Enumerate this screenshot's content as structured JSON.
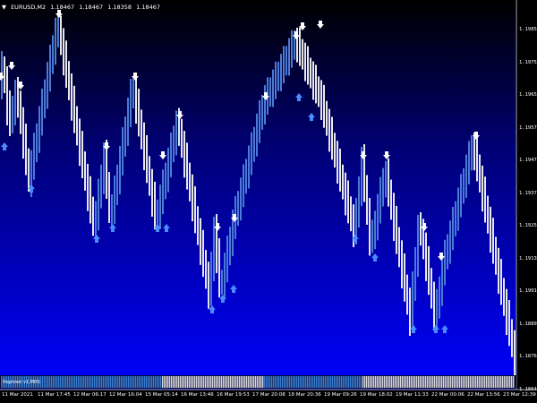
{
  "window": {
    "symbol": "EURUSD,M2",
    "bid": "1.18467",
    "high": "1.18467",
    "low": "1.18358",
    "close": "1.18467"
  },
  "indicator": {
    "label": "Nephred v1.MHS"
  },
  "price_axis": [
    "1.19855",
    "1.19755",
    "1.19655",
    "1.19570",
    "1.19475",
    "1.19375",
    "1.19255",
    "1.19130",
    "1.19010",
    "1.18890",
    "1.18765",
    "1.18645"
  ],
  "time_axis": [
    "11 Mar 2021",
    "11 Mar 17:45",
    "12 Mar 06:17",
    "12 Mar 16:04",
    "15 Mar 05:14",
    "16 Mar 13:46",
    "16 Mar 19:53",
    "17 Mar 20:08",
    "18 Mar 20:36",
    "19 Mar 09:26",
    "19 Mar 18:02",
    "19 Mar 11:33",
    "22 Mar 00:06",
    "22 Mar 13:56",
    "23 Mar 12:39"
  ],
  "colors": {
    "bull_bar": "#4a7bd6",
    "bear_bar": "#e8e8ea",
    "down_arrow": "#ffffff",
    "up_arrow": "#4a8cff",
    "background_top": "#000000",
    "background_bottom": "#0000ff"
  },
  "chart_data": {
    "type": "candlestick",
    "symbol": "EURUSD",
    "timeframe": "M2",
    "pivots": [
      {
        "t": "11 Mar 2021",
        "price": 1.1955
      },
      {
        "t": "11 Mar 17:45",
        "price": 1.193
      },
      {
        "t": "12 Mar 06:17",
        "price": 1.199
      },
      {
        "t": "12 Mar 16:04",
        "price": 1.192
      },
      {
        "t": "15 Mar 05:14",
        "price": 1.195
      },
      {
        "t": "16 Mar 13:46",
        "price": 1.1925
      },
      {
        "t": "16 Mar 19:53",
        "price": 1.1935
      },
      {
        "t": "17 Mar 20:08",
        "price": 1.188
      },
      {
        "t": "18 Mar 20:36",
        "price": 1.1985
      },
      {
        "t": "19 Mar 09:26",
        "price": 1.192
      },
      {
        "t": "19 Mar 18:02",
        "price": 1.193
      },
      {
        "t": "19 Mar 11:33",
        "price": 1.187
      },
      {
        "t": "22 Mar 13:56",
        "price": 1.194
      },
      {
        "t": "23 Mar 12:39",
        "price": 1.1864
      }
    ],
    "ylim": [
      1.186,
      1.1995
    ],
    "grid": false,
    "signals": {
      "sell_arrows": 17,
      "buy_arrows": 16
    }
  }
}
